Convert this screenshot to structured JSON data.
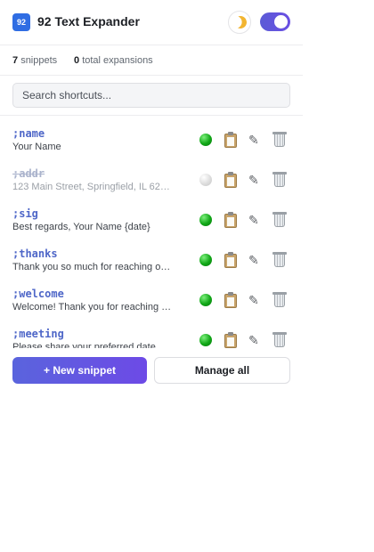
{
  "header": {
    "logo_text": "92",
    "title": "92 Text Expander",
    "theme_icon": "moon-icon",
    "enabled": true
  },
  "stats": {
    "snippets_count": "7",
    "snippets_label": "snippets",
    "expansions_count": "0",
    "expansions_label": "total expansions"
  },
  "search": {
    "placeholder": "Search shortcuts...",
    "value": ""
  },
  "snippets": [
    {
      "shortcut": ";name",
      "expansion": "Your Name",
      "enabled": true
    },
    {
      "shortcut": ";addr",
      "expansion": "123 Main Street, Springfield, IL 62…",
      "enabled": false
    },
    {
      "shortcut": ";sig",
      "expansion": "Best regards, Your Name {date}",
      "enabled": true
    },
    {
      "shortcut": ";thanks",
      "expansion": "Thank you so much for reaching o…",
      "enabled": true
    },
    {
      "shortcut": ";welcome",
      "expansion": "Welcome! Thank you for reaching …",
      "enabled": true
    },
    {
      "shortcut": ";meeting",
      "expansion": "Please share your preferred date …",
      "enabled": true
    }
  ],
  "row_icons": [
    "clipboard-icon",
    "pencil-icon",
    "trash-icon"
  ],
  "footer": {
    "new_label": "+ New snippet",
    "manage_label": "Manage all"
  },
  "colors": {
    "accent": "#5b5bd6",
    "shortcut": "#4f67c8",
    "status_on": "#10a616",
    "status_off": "#dadada"
  }
}
